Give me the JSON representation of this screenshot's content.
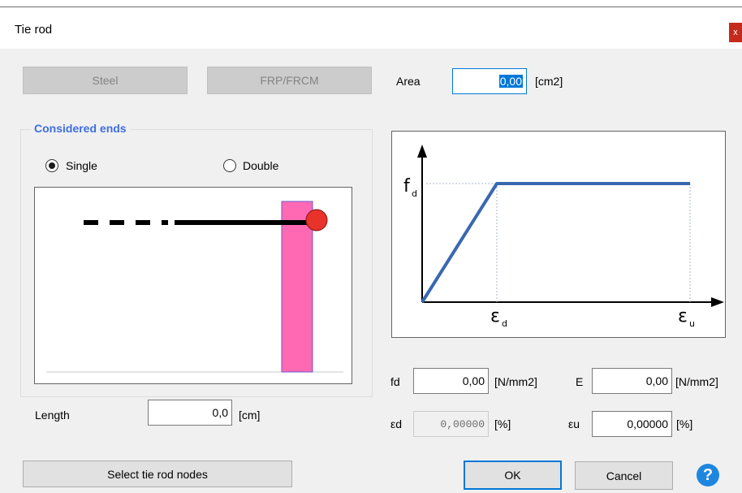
{
  "window": {
    "title": "Tie rod",
    "close_label": "x"
  },
  "material_buttons": {
    "steel": "Steel",
    "frp": "FRP/FRCM"
  },
  "area": {
    "label": "Area",
    "value": "0,00",
    "unit": "[cm2]"
  },
  "ends": {
    "group_title": "Considered ends",
    "single_label": "Single",
    "double_label": "Double",
    "selected": "Single"
  },
  "length": {
    "label": "Length",
    "value": "0,0",
    "unit": "[cm]"
  },
  "graph": {
    "y_label": "f",
    "y_label_sub": "d",
    "x_label_d": "ε",
    "x_label_d_sub": "d",
    "x_label_u": "ε",
    "x_label_u_sub": "u",
    "line_color": "#3a68b0"
  },
  "fields": {
    "fd": {
      "label": "fd",
      "value": "0,00",
      "unit": "[N/mm2]"
    },
    "E": {
      "label": "E",
      "value": "0,00",
      "unit": "[N/mm2]"
    },
    "ed": {
      "label": "εd",
      "value": "0,00000",
      "unit": "[%]"
    },
    "eu": {
      "label": "εu",
      "value": "0,00000",
      "unit": "[%]"
    }
  },
  "buttons": {
    "select_nodes": "Select tie rod nodes",
    "ok": "OK",
    "cancel": "Cancel",
    "help": "?"
  },
  "colors": {
    "column": "#ff69b4",
    "node": "#e8322a",
    "accent": "#0078d7",
    "group_title": "#3d6ee0"
  }
}
